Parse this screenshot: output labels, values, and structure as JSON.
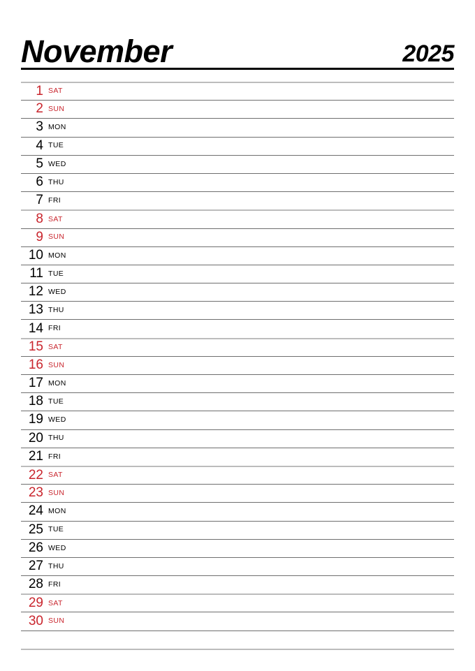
{
  "header": {
    "month": "November",
    "year": "2025"
  },
  "colors": {
    "weekend": "#c9252d",
    "weekday": "#000000",
    "rule_strong": "#000000",
    "rule_day": "#6e6e6e",
    "rule_week": "#bcbcbc",
    "background": "#ffffff"
  },
  "days": [
    {
      "num": "1",
      "name": "SAT",
      "weekend": true,
      "week_start": true
    },
    {
      "num": "2",
      "name": "SUN",
      "weekend": true,
      "week_start": false
    },
    {
      "num": "3",
      "name": "MON",
      "weekend": false,
      "week_start": false
    },
    {
      "num": "4",
      "name": "TUE",
      "weekend": false,
      "week_start": false
    },
    {
      "num": "5",
      "name": "WED",
      "weekend": false,
      "week_start": false
    },
    {
      "num": "6",
      "name": "THU",
      "weekend": false,
      "week_start": false
    },
    {
      "num": "7",
      "name": "FRI",
      "weekend": false,
      "week_start": false
    },
    {
      "num": "8",
      "name": "SAT",
      "weekend": true,
      "week_start": true
    },
    {
      "num": "9",
      "name": "SUN",
      "weekend": true,
      "week_start": false
    },
    {
      "num": "10",
      "name": "MON",
      "weekend": false,
      "week_start": false
    },
    {
      "num": "11",
      "name": "TUE",
      "weekend": false,
      "week_start": false
    },
    {
      "num": "12",
      "name": "WED",
      "weekend": false,
      "week_start": false
    },
    {
      "num": "13",
      "name": "THU",
      "weekend": false,
      "week_start": false
    },
    {
      "num": "14",
      "name": "FRI",
      "weekend": false,
      "week_start": false
    },
    {
      "num": "15",
      "name": "SAT",
      "weekend": true,
      "week_start": true
    },
    {
      "num": "16",
      "name": "SUN",
      "weekend": true,
      "week_start": false
    },
    {
      "num": "17",
      "name": "MON",
      "weekend": false,
      "week_start": false
    },
    {
      "num": "18",
      "name": "TUE",
      "weekend": false,
      "week_start": false
    },
    {
      "num": "19",
      "name": "WED",
      "weekend": false,
      "week_start": false
    },
    {
      "num": "20",
      "name": "THU",
      "weekend": false,
      "week_start": false
    },
    {
      "num": "21",
      "name": "FRI",
      "weekend": false,
      "week_start": false
    },
    {
      "num": "22",
      "name": "SAT",
      "weekend": true,
      "week_start": true
    },
    {
      "num": "23",
      "name": "SUN",
      "weekend": true,
      "week_start": false
    },
    {
      "num": "24",
      "name": "MON",
      "weekend": false,
      "week_start": false
    },
    {
      "num": "25",
      "name": "TUE",
      "weekend": false,
      "week_start": false
    },
    {
      "num": "26",
      "name": "WED",
      "weekend": false,
      "week_start": false
    },
    {
      "num": "27",
      "name": "THU",
      "weekend": false,
      "week_start": false
    },
    {
      "num": "28",
      "name": "FRI",
      "weekend": false,
      "week_start": false
    },
    {
      "num": "29",
      "name": "SAT",
      "weekend": true,
      "week_start": true
    },
    {
      "num": "30",
      "name": "SUN",
      "weekend": true,
      "week_start": false
    }
  ]
}
